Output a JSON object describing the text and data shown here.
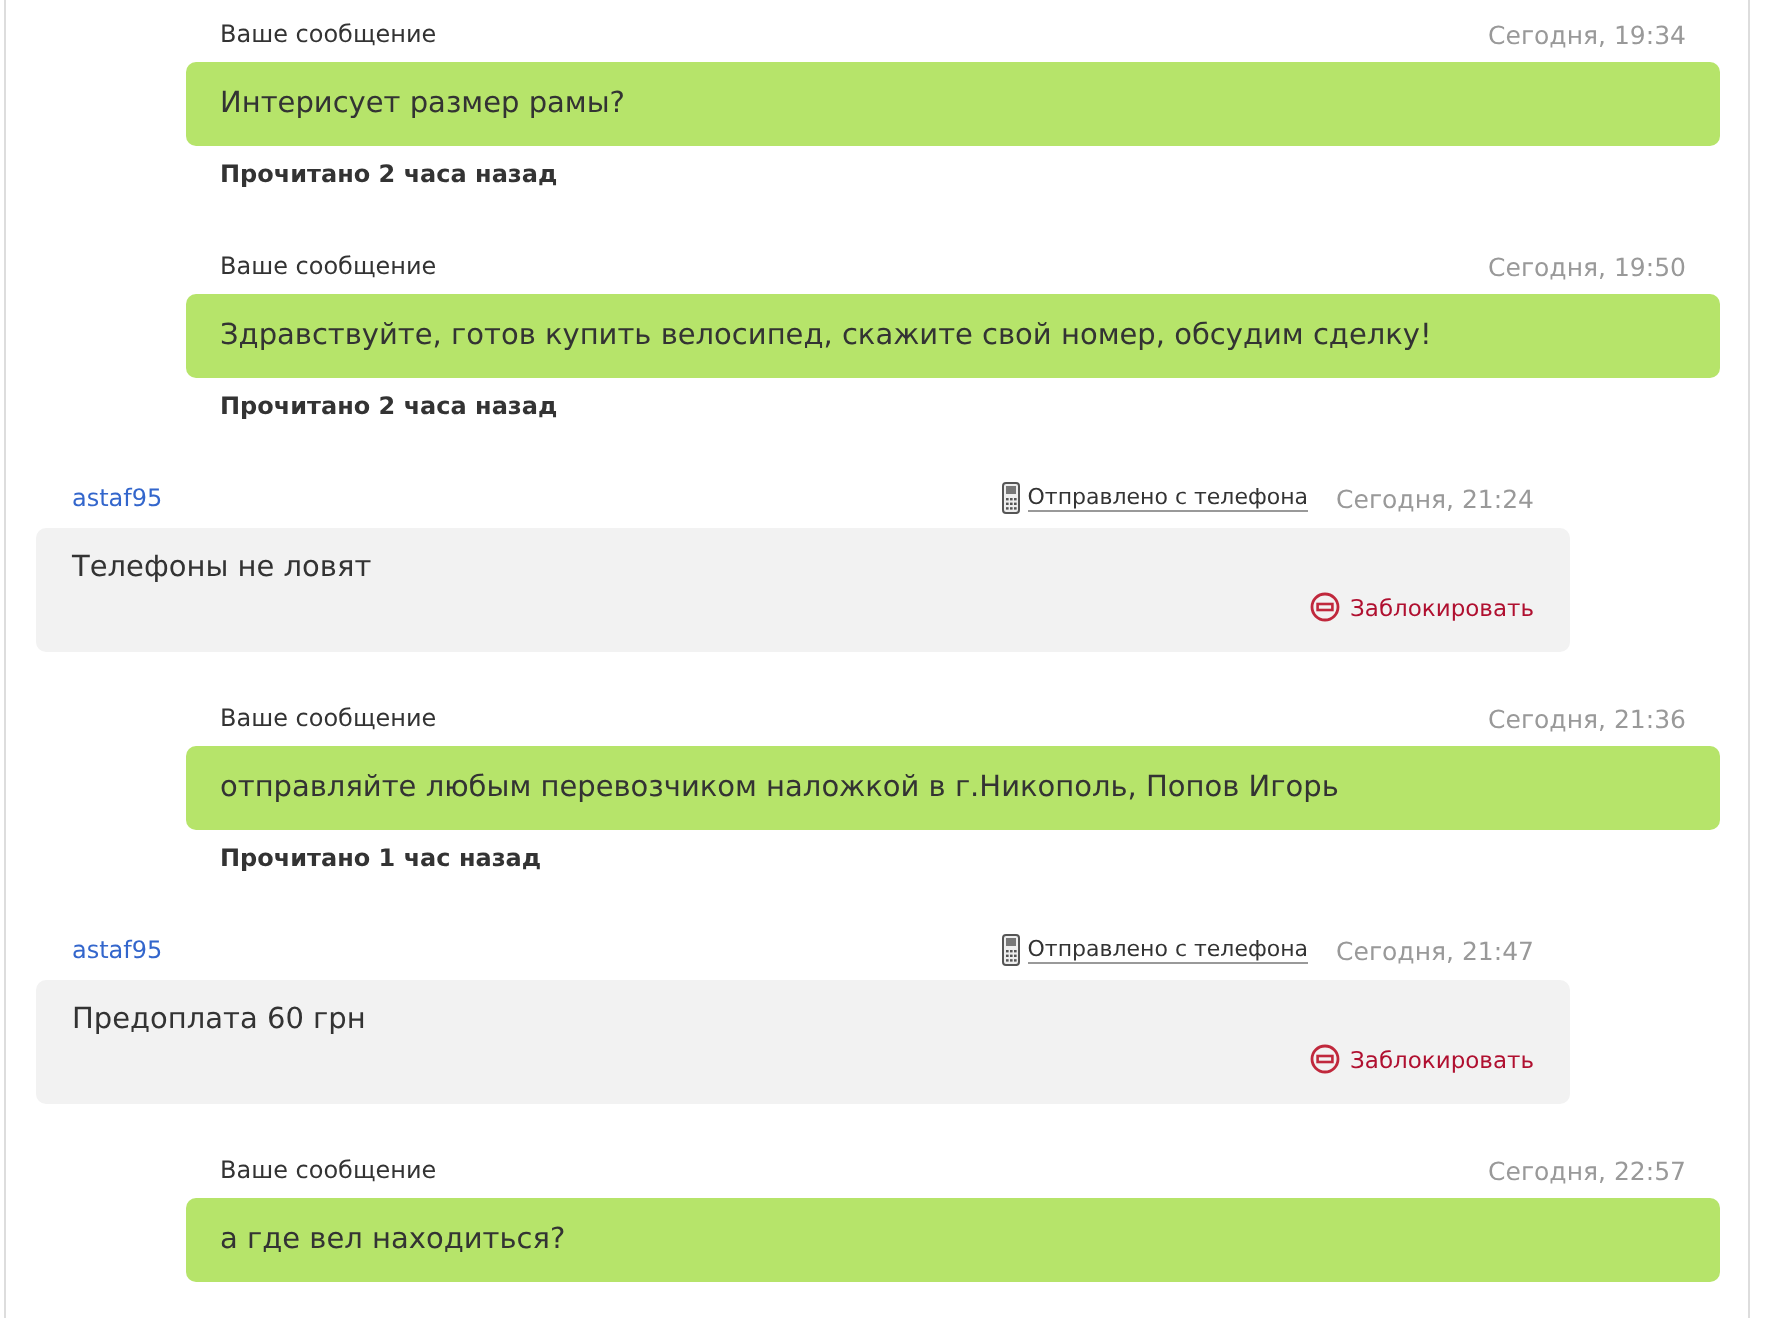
{
  "messages": [
    {
      "kind": "own",
      "author": "Ваше сообщение",
      "time": "Сегодня, 19:34",
      "text": "Интерисует размер рамы?",
      "status": "Прочитано 2 часа назад"
    },
    {
      "kind": "own",
      "author": "Ваше сообщение",
      "time": "Сегодня, 19:50",
      "text": "Здравствуйте, готов купить велосипед, скажите свой номер, обсудим сделку!",
      "status": "Прочитано 2 часа назад"
    },
    {
      "kind": "incoming",
      "author": "astaf95",
      "source": "Отправлено с телефона",
      "time": "Сегодня, 21:24",
      "text": "Телефоны не ловят",
      "action": "Заблокировать"
    },
    {
      "kind": "own",
      "author": "Ваше сообщение",
      "time": "Сегодня, 21:36",
      "text": "отправляйте любым перевозчиком наложкой в г.Никополь, Попов Игорь",
      "status": "Прочитано 1 час назад"
    },
    {
      "kind": "incoming",
      "author": "astaf95",
      "source": "Отправлено с телефона",
      "time": "Сегодня, 21:47",
      "text": "Предоплата 60 грн",
      "action": "Заблокировать"
    },
    {
      "kind": "own",
      "author": "Ваше сообщение",
      "time": "Сегодня, 22:57",
      "text": "а где вел находиться?"
    }
  ]
}
